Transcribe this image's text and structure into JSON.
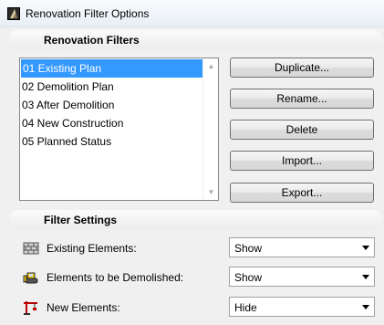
{
  "window": {
    "title": "Renovation Filter Options"
  },
  "renovation_filters": {
    "header": "Renovation Filters",
    "items": [
      {
        "label": "01 Existing Plan",
        "selected": true
      },
      {
        "label": "02 Demolition Plan",
        "selected": false
      },
      {
        "label": "03 After Demolition",
        "selected": false
      },
      {
        "label": "04 New Construction",
        "selected": false
      },
      {
        "label": "05 Planned Status",
        "selected": false
      }
    ]
  },
  "buttons": {
    "duplicate": "Duplicate...",
    "rename": "Rename...",
    "delete": "Delete",
    "import": "Import...",
    "export": "Export..."
  },
  "filter_settings": {
    "header": "Filter Settings",
    "rows": [
      {
        "label": "Existing Elements:",
        "value": "Show",
        "icon": "brick-wall-icon"
      },
      {
        "label": "Elements to be Demolished:",
        "value": "Show",
        "icon": "bulldozer-icon"
      },
      {
        "label": "New Elements:",
        "value": "Hide",
        "icon": "crane-icon"
      }
    ]
  },
  "colors": {
    "selection": "#3399ff",
    "title_bar": "#e8eef6"
  }
}
